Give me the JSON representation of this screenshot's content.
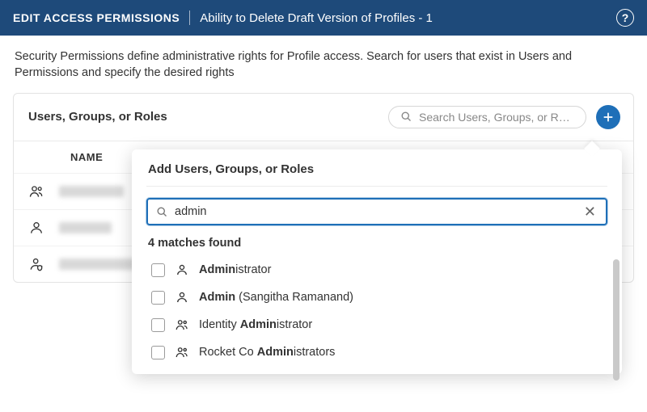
{
  "header": {
    "title": "EDIT ACCESS PERMISSIONS",
    "subtitle": "Ability to Delete Draft Version of Profiles - 1"
  },
  "description": "Security Permissions define administrative rights for Profile access. Search for users that exist in Users and Permissions and specify the desired rights",
  "panel": {
    "title": "Users, Groups, or Roles",
    "search_placeholder": "Search Users, Groups, or R…",
    "columns": {
      "name": "NAME"
    }
  },
  "popover": {
    "title": "Add Users, Groups, or Roles",
    "search_value": "admin",
    "matches_label": "4 matches found",
    "results": [
      {
        "icon": "user",
        "prefix": "Admin",
        "rest_after_prefix": "istrator",
        "suffix": ""
      },
      {
        "icon": "user",
        "prefix": "Admin",
        "rest_after_prefix": "",
        "suffix": " (Sangitha Ramanand)"
      },
      {
        "icon": "group",
        "before": "Identity ",
        "match": "Admin",
        "after": "istrator"
      },
      {
        "icon": "group",
        "before": "Rocket Co ",
        "match": "Admin",
        "after": "istrators"
      }
    ]
  }
}
